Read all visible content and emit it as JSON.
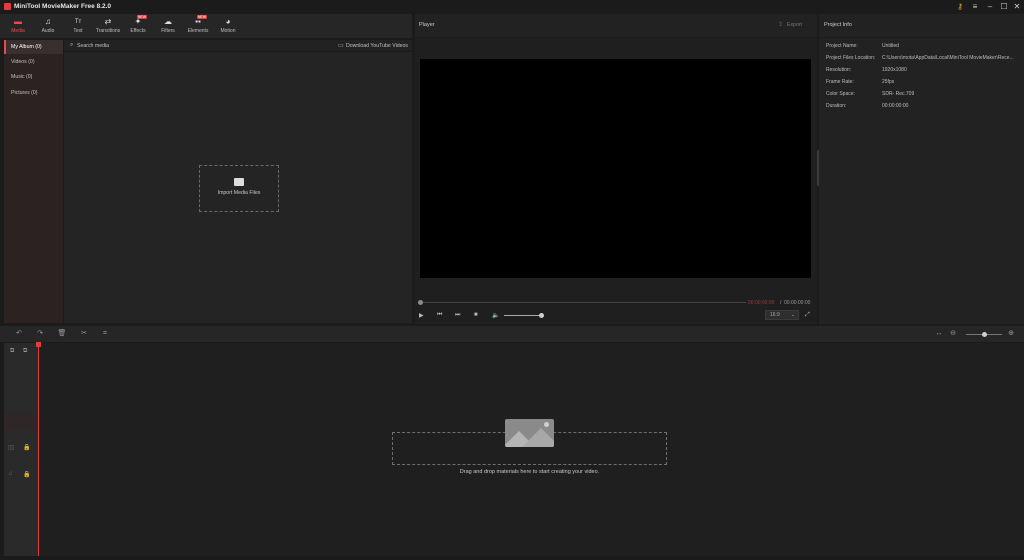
{
  "app": {
    "title": "MiniTool MovieMaker Free 8.2.0"
  },
  "toolbar": {
    "items": [
      {
        "label": "Media",
        "icon": "folder-icon",
        "glyph": "▬"
      },
      {
        "label": "Audio",
        "icon": "music-note-icon",
        "glyph": "♫"
      },
      {
        "label": "Text",
        "icon": "text-icon",
        "glyph": "Tт"
      },
      {
        "label": "Transitions",
        "icon": "transitions-icon",
        "glyph": "⇄"
      },
      {
        "label": "Effects",
        "icon": "effects-icon",
        "glyph": "✦"
      },
      {
        "label": "Filters",
        "icon": "filters-icon",
        "glyph": "☁"
      },
      {
        "label": "Elements",
        "icon": "elements-icon",
        "glyph": "▪▪"
      },
      {
        "label": "Motion",
        "icon": "motion-icon",
        "glyph": "◕"
      }
    ],
    "badge": "NEW"
  },
  "sidebar": {
    "items": [
      {
        "label": "My Album (0)"
      },
      {
        "label": "Videos (0)"
      },
      {
        "label": "Music (0)"
      },
      {
        "label": "Pictures (0)"
      }
    ]
  },
  "media": {
    "search_label": "Search media",
    "download_label": "Download YouTube Videos",
    "import_label": "Import Media Files"
  },
  "player": {
    "title": "Player",
    "export_label": "Export",
    "time_current": "00:00:00:00",
    "time_separator": "/",
    "time_total": "00:00:00:00",
    "aspect": "16:9"
  },
  "project_info": {
    "title": "Project Info",
    "rows": [
      {
        "label": "Project Name:",
        "value": "Untitled"
      },
      {
        "label": "Project Files Location:",
        "value": "C:\\Users\\mota\\AppData\\Local\\MiniTool MovieMaker\\Rece..."
      },
      {
        "label": "Resolution:",
        "value": "1920x1080"
      },
      {
        "label": "Frame Rate:",
        "value": "25fps"
      },
      {
        "label": "Color Space:",
        "value": "SDR- Rec.709"
      },
      {
        "label": "Duration:",
        "value": "00:00:00:00"
      }
    ]
  },
  "timeline": {
    "drop_text": "Drag and drop materials here to start creating your video."
  },
  "colors": {
    "accent": "#e94b4b",
    "background": "#1b1b1b",
    "panel": "#242424"
  }
}
